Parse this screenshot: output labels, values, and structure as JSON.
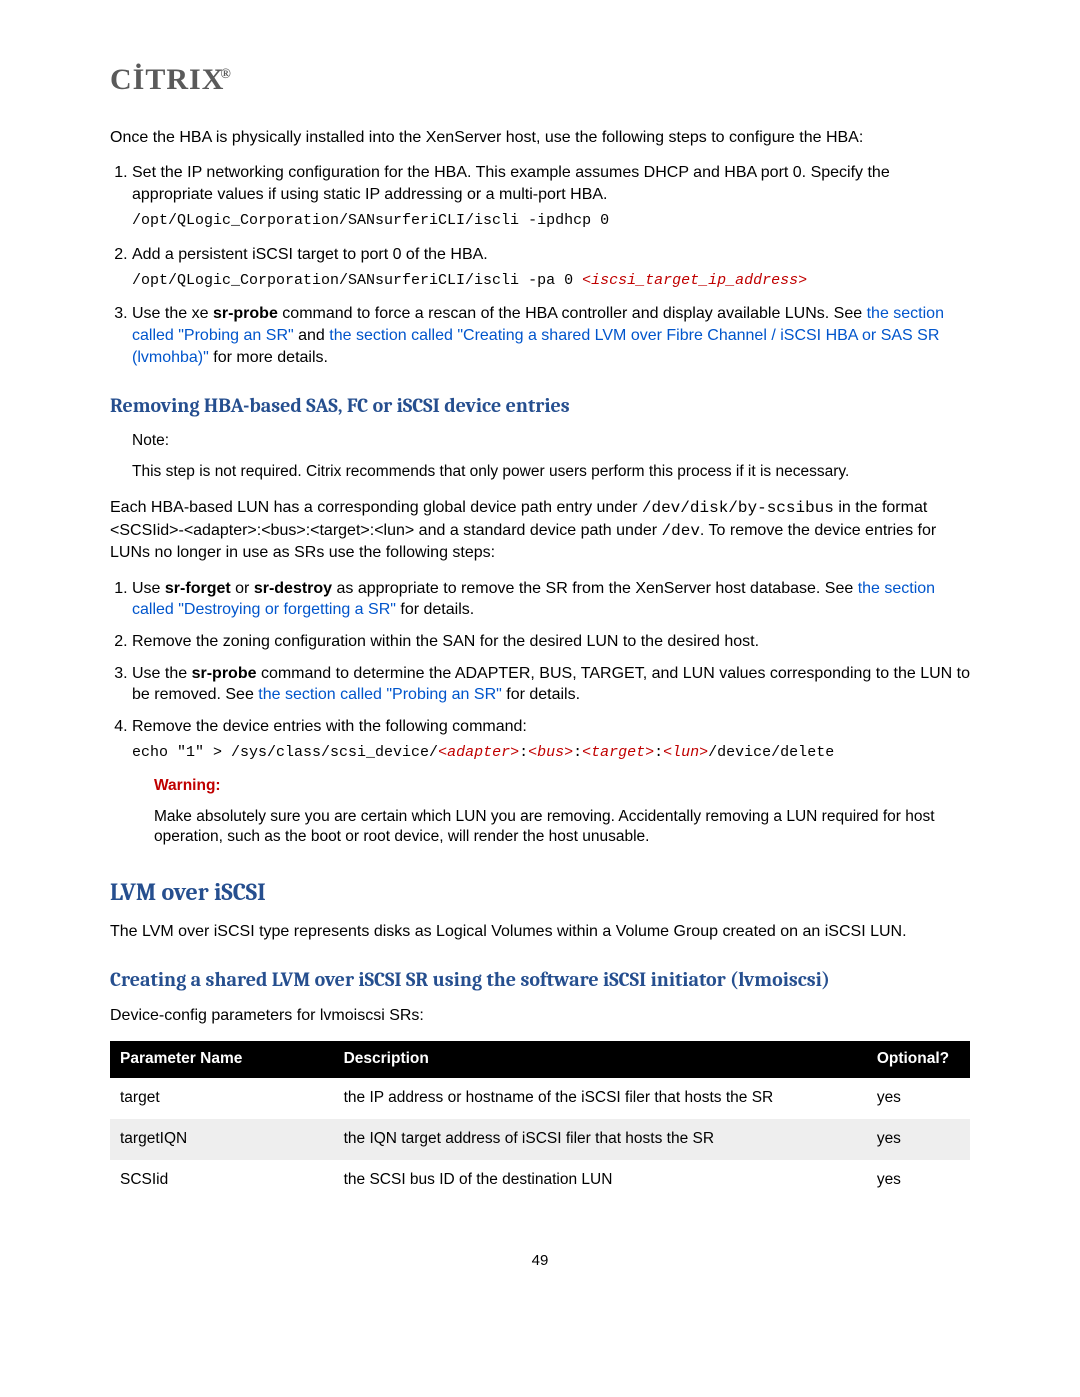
{
  "logo": "CİTRIX",
  "intro": "Once the HBA is physically installed into the XenServer host, use the following steps to configure the HBA:",
  "steps1": {
    "s1": "Set the IP networking configuration for the HBA. This example assumes DHCP and HBA port 0. Specify the appropriate values if using static IP addressing or a multi-port HBA.",
    "code1": "/opt/QLogic_Corporation/SANsurferiCLI/iscli -ipdhcp 0",
    "s2": "Add a persistent iSCSI target to port 0 of the HBA.",
    "code2a": "/opt/QLogic_Corporation/SANsurferiCLI/iscli -pa 0 ",
    "code2b": "<iscsi_target_ip_address>",
    "s3a": "Use the xe ",
    "s3b": "sr-probe",
    "s3c": " command to force a rescan of the HBA controller and display available LUNs. See ",
    "s3link1": "the section called \"Probing an SR\"",
    "s3d": " and ",
    "s3link2": "the section called \"Creating a shared LVM over Fibre Channel / iSCSI HBA or SAS SR (lvmohba)\"",
    "s3e": " for more details."
  },
  "h_remove": "Removing HBA-based SAS, FC or iSCSI device entries",
  "note": {
    "label": "Note:",
    "text": "This step is not required. Citrix recommends that only power users perform this process if it is necessary."
  },
  "para_each_1": "Each HBA-based LUN has a corresponding global device path entry under ",
  "para_each_mono1": "/dev/disk/by-scsibus",
  "para_each_2": " in the format <SCSIid>-<adapter>:<bus>:<target>:<lun> and a standard device path under ",
  "para_each_mono2": "/dev",
  "para_each_3": ". To remove the device entries for LUNs no longer in use as SRs use the following steps:",
  "steps2": {
    "s1a": "Use ",
    "s1b1": "sr-forget",
    "s1c": " or ",
    "s1b2": "sr-destroy",
    "s1d": " as appropriate to remove the SR from the XenServer host database. See ",
    "s1link": "the section called \"Destroying or forgetting a SR\"",
    "s1e": " for details.",
    "s2": "Remove the zoning configuration within the SAN for the desired LUN to the desired host.",
    "s3a": "Use the ",
    "s3b": "sr-probe",
    "s3c": " command to determine the ADAPTER, BUS, TARGET, and LUN values corresponding to the LUN to be removed. See ",
    "s3link": "the section called \"Probing an SR\"",
    "s3d": " for details.",
    "s4": "Remove the device entries with the following command:",
    "code4a": "echo \"1\" > /sys/class/scsi_device/",
    "code4v1": "<adapter>",
    "code4s": ":",
    "code4v2": "<bus>",
    "code4v3": "<target>",
    "code4v4": "<lun>",
    "code4b": "/device/delete"
  },
  "warn": {
    "label": "Warning:",
    "text": "Make absolutely sure you are certain which LUN you are removing. Accidentally removing a LUN required for host operation, such as the boot or root device, will render the host unusable."
  },
  "h_lvm": "LVM over iSCSI",
  "lvm_para": "The LVM over iSCSI type represents disks as Logical Volumes within a Volume Group created on an iSCSI LUN.",
  "h_create": "Creating a shared LVM over iSCSI SR using the software iSCSI initiator (lvmoiscsi)",
  "devconf": "Device-config parameters for lvmoiscsi SRs:",
  "table": {
    "h1": "Parameter Name",
    "h2": "Description",
    "h3": "Optional?",
    "r1c1": "target",
    "r1c2": "the IP address or hostname of the iSCSI filer that hosts the SR",
    "r1c3": "yes",
    "r2c1": "targetIQN",
    "r2c2": "the IQN target address of iSCSI filer that hosts the SR",
    "r2c3": "yes",
    "r3c1": "SCSIid",
    "r3c2": "the SCSI bus ID of the destination LUN",
    "r3c3": "yes"
  },
  "page": "49"
}
